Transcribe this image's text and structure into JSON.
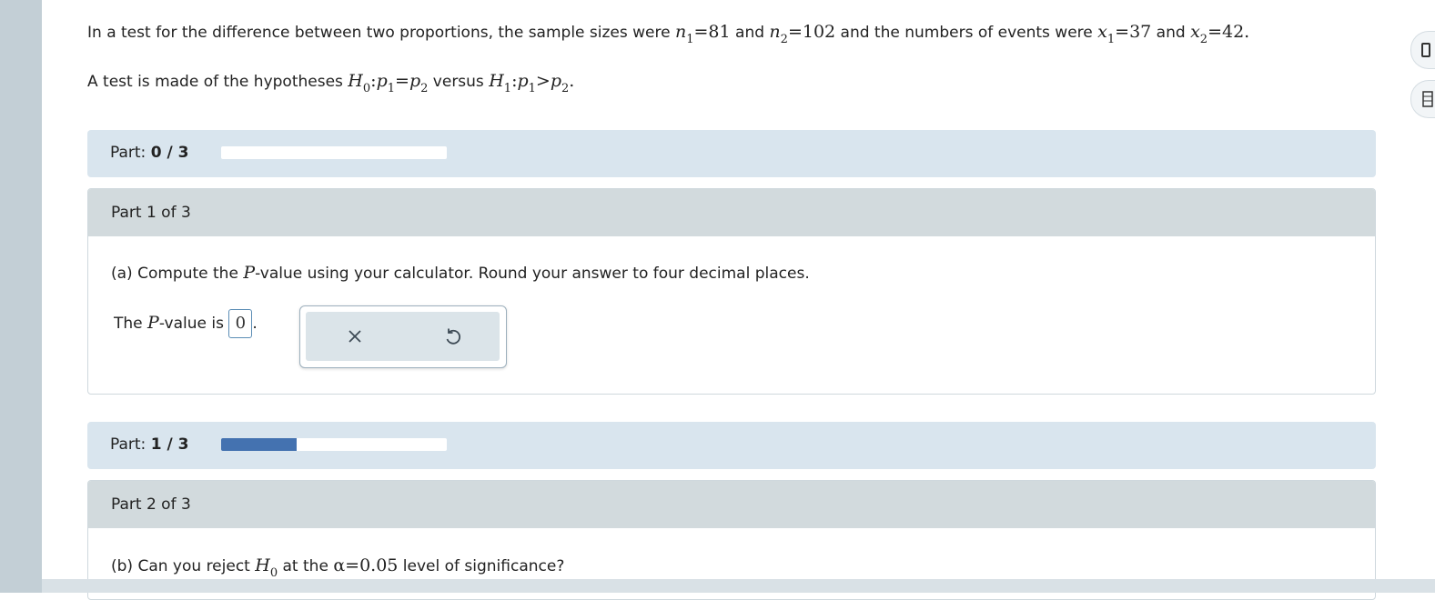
{
  "question": {
    "line1": {
      "t1": "In a test for the difference between two proportions, the sample sizes were ",
      "n1_var": "n",
      "n1_sub": "1",
      "n1_val": "=81",
      "and1": " and ",
      "n2_var": "n",
      "n2_sub": "2",
      "n2_val": "=102",
      "t2": " and the numbers of events were ",
      "x1_var": "x",
      "x1_sub": "1",
      "x1_val": "=37",
      "and2": " and ",
      "x2_var": "x",
      "x2_sub": "2",
      "x2_val": "=42."
    },
    "line2": {
      "t1": "A test is made of the hypotheses ",
      "h0_var": "H",
      "h0_sub": "0",
      "h0_rel": ":",
      "p1_var": "p",
      "p1_sub": "1",
      "eq": "=",
      "p2_var": "p",
      "p2_sub": "2",
      "versus": " versus ",
      "h1_var": "H",
      "h1_sub": "1",
      "h1_rel": ":",
      "p1b_var": "p",
      "p1b_sub": "1",
      "gt": ">",
      "p2b_var": "p",
      "p2b_sub": "2",
      "end": "."
    }
  },
  "progress_bars": [
    {
      "label": "Part: ",
      "value": "0 / 3",
      "fraction": 0.0
    },
    {
      "label": "Part: ",
      "value": "1 / 3",
      "fraction": 0.333
    }
  ],
  "part1": {
    "header": "Part 1 of 3",
    "question_pre": "(a) Compute the ",
    "question_var": "P",
    "question_post": "-value using your calculator. Round your answer to four decimal places.",
    "answer_pre": "The ",
    "answer_var": "P",
    "answer_post": "-value is ",
    "answer_value": "0",
    "answer_end": "."
  },
  "part2": {
    "header": "Part 2 of 3",
    "question_pre": "(b) Can you reject ",
    "h_var": "H",
    "h_sub": "0",
    "question_mid": " at the ",
    "alpha": "α=0.05",
    "question_post": " level of significance?"
  },
  "tools": {
    "clear_icon": "close-icon",
    "undo_icon": "undo-icon"
  },
  "colors": {
    "progress_fill": "#4472b0",
    "part_bar_bg": "#d9e5ee",
    "part_header_bg": "#d2dadd",
    "answer_border": "#5b8db5"
  }
}
